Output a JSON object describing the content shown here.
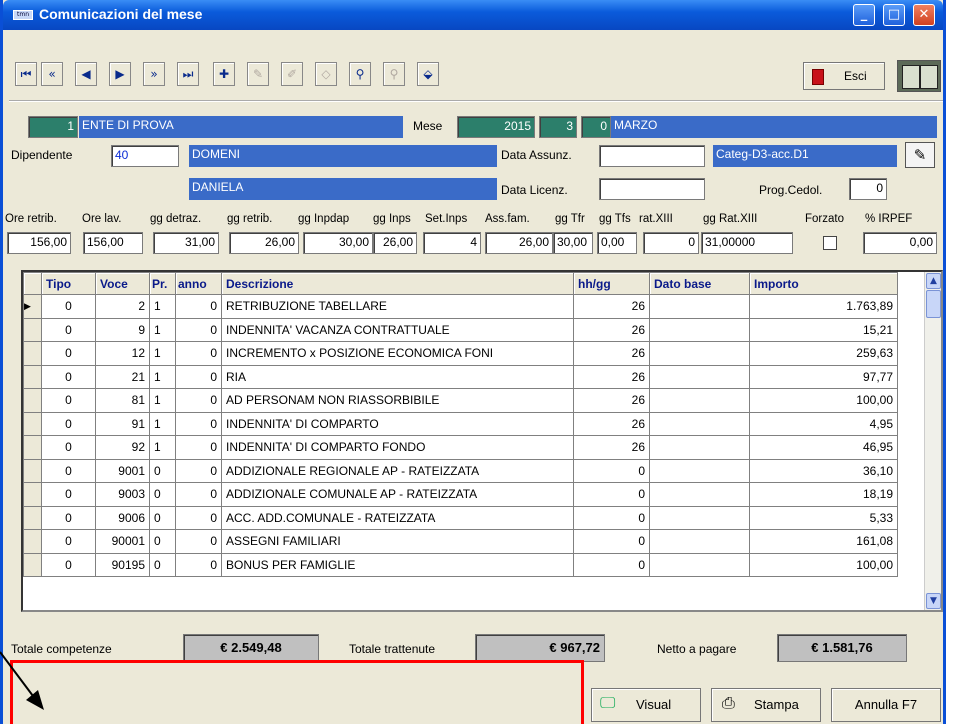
{
  "window": {
    "title": "Comunicazioni del mese",
    "app_icon": "tmn"
  },
  "toolbar": {
    "icons": [
      "first-record-icon",
      "prev-page-icon",
      "prev-record-icon",
      "next-record-icon",
      "next-page-icon",
      "last-record-icon",
      "add-record-icon",
      "edit-record-icon",
      "delete-record-icon",
      "post-icon",
      "find-icon",
      "find-next-icon",
      "filter-icon"
    ],
    "esci_label": "Esci"
  },
  "header": {
    "ente_code": "1",
    "ente_name": "ENTE DI PROVA",
    "mese_label": "Mese",
    "anno": "2015",
    "mese_num": "3",
    "mese_extra": "0",
    "mese_name": "MARZO",
    "dipendente_label": "Dipendente",
    "dipendente_code": "40",
    "cognome": "DOMENI",
    "nome": "DANIELA",
    "data_assunz_label": "Data Assunz.",
    "data_assunz": "",
    "data_licenz_label": "Data Licenz.",
    "data_licenz": "",
    "categoria": "Categ-D3-acc.D1",
    "prog_cedol_label": "Prog.Cedol.",
    "prog_cedol": "0"
  },
  "params": {
    "labels": [
      "Ore retrib.",
      "Ore lav.",
      "gg detraz.",
      "gg retrib.",
      "gg Inpdap",
      "gg Inps",
      "Set.Inps",
      "Ass.fam.",
      "gg Tfr",
      "gg Tfs",
      "rat.XIII",
      "gg Rat.XIII",
      "Forzato",
      "% IRPEF"
    ],
    "values": [
      "156,00",
      "156,00",
      "31,00",
      "26,00",
      "30,00",
      "26,00",
      "4",
      "26,00",
      "30,00",
      "0,00",
      "0",
      "31,00000",
      "",
      "0,00"
    ]
  },
  "grid": {
    "columns": [
      "Tipo",
      "Voce",
      "Pr.",
      "anno",
      "Descrizione",
      "hh/gg",
      "Dato base",
      "Importo"
    ],
    "rows": [
      [
        "0",
        "2",
        "1",
        "0",
        "RETRIBUZIONE TABELLARE",
        "26",
        "",
        "1.763,89"
      ],
      [
        "0",
        "9",
        "1",
        "0",
        "INDENNITA' VACANZA CONTRATTUALE",
        "26",
        "",
        "15,21"
      ],
      [
        "0",
        "12",
        "1",
        "0",
        "INCREMENTO x POSIZIONE ECONOMICA FONI",
        "26",
        "",
        "259,63"
      ],
      [
        "0",
        "21",
        "1",
        "0",
        "RIA",
        "26",
        "",
        "97,77"
      ],
      [
        "0",
        "81",
        "1",
        "0",
        "AD PERSONAM NON RIASSORBIBILE",
        "26",
        "",
        "100,00"
      ],
      [
        "0",
        "91",
        "1",
        "0",
        "INDENNITA' DI COMPARTO",
        "26",
        "",
        "4,95"
      ],
      [
        "0",
        "92",
        "1",
        "0",
        "INDENNITA' DI COMPARTO FONDO",
        "26",
        "",
        "46,95"
      ],
      [
        "0",
        "9001",
        "0",
        "0",
        "ADDIZIONALE REGIONALE AP - RATEIZZATA",
        "0",
        "",
        "36,10"
      ],
      [
        "0",
        "9003",
        "0",
        "0",
        "ADDIZIONALE COMUNALE AP - RATEIZZATA",
        "0",
        "",
        "18,19"
      ],
      [
        "0",
        "9006",
        "0",
        "0",
        "ACC. ADD.COMUNALE - RATEIZZATA",
        "0",
        "",
        "5,33"
      ],
      [
        "0",
        "90001",
        "0",
        "0",
        "ASSEGNI FAMILIARI",
        "0",
        "",
        "161,08"
      ],
      [
        "0",
        "90195",
        "0",
        "0",
        "BONUS PER FAMIGLIE",
        "0",
        "",
        "100,00"
      ]
    ]
  },
  "totals": {
    "competenze_label": "Totale competenze",
    "competenze": "€ 2.549,48",
    "trattenute_label": "Totale trattenute",
    "trattenute": "€ 967,72",
    "netto_label": "Netto a pagare",
    "netto": "€ 1.581,76"
  },
  "buttons": {
    "visual": "Visual",
    "stampa": "Stampa",
    "annulla": "Annulla F7"
  },
  "colors": {
    "title_blue": "#0a5bdb",
    "teal": "#2c7f6b",
    "blue_field": "#3a6bc8",
    "annotation_red": "#ff0000"
  }
}
